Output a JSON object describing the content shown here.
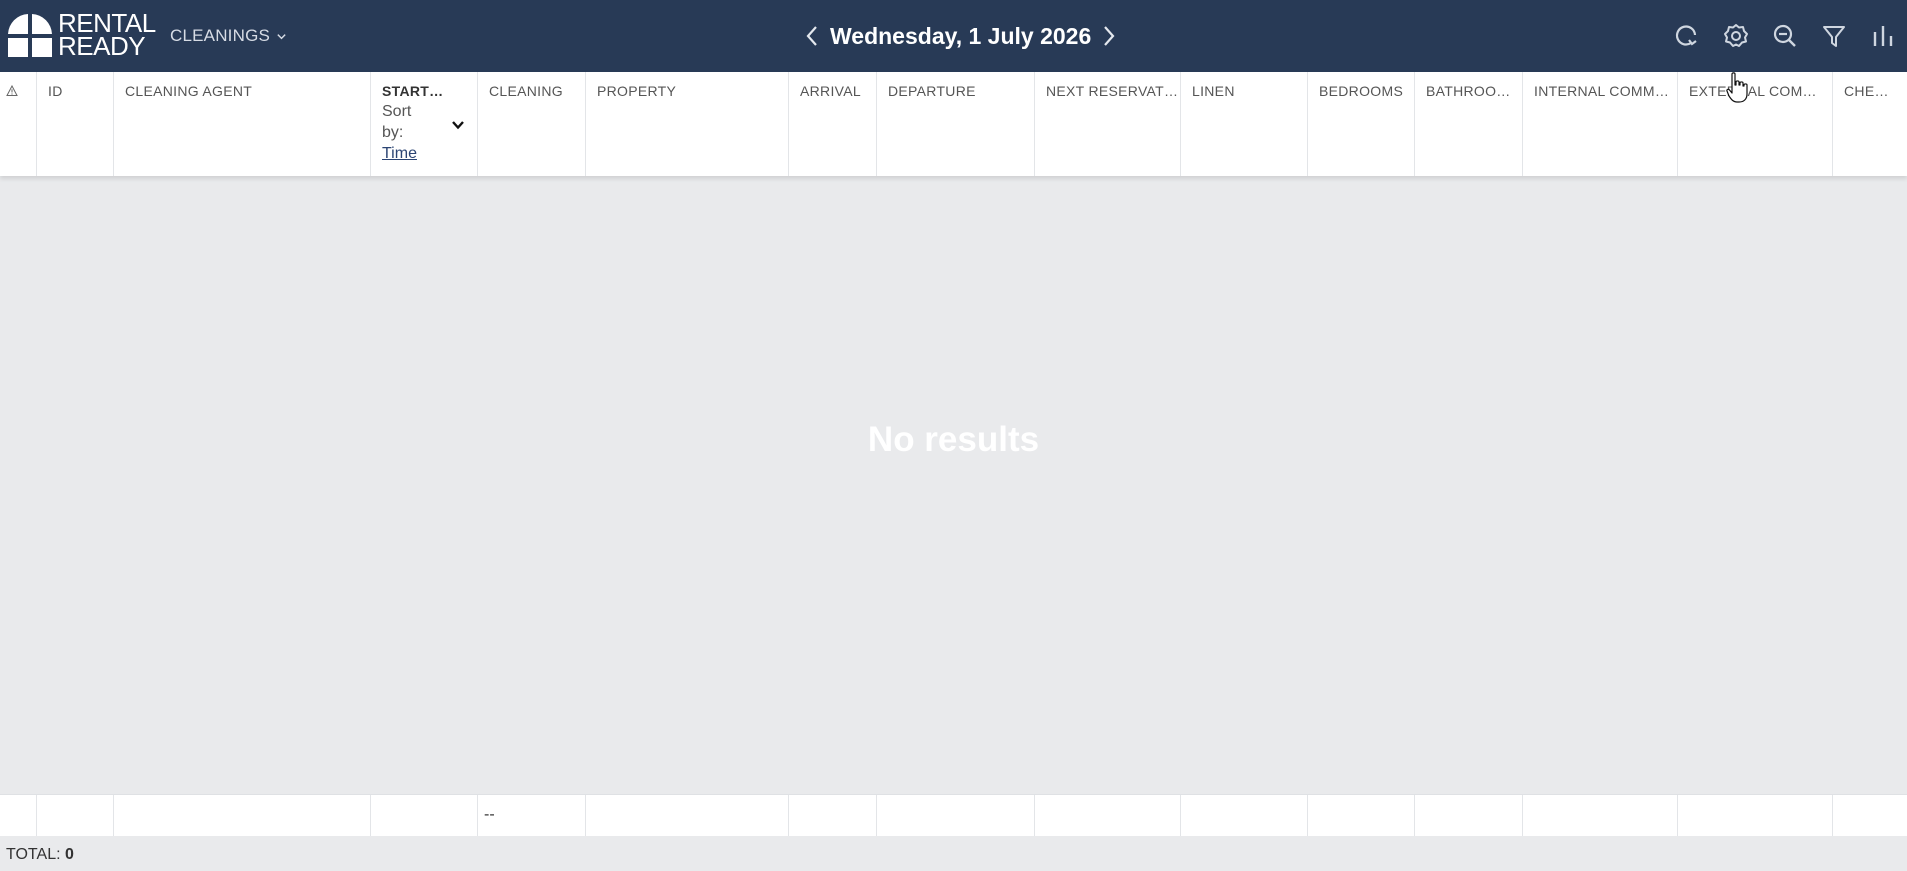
{
  "brand": {
    "line1": "RENTAL",
    "line2": "READY",
    "logo_icon": "rental-ready-logo"
  },
  "module": {
    "label": "CLEANINGS",
    "icon": "chevron-down-icon"
  },
  "date_nav": {
    "date": "Wednesday, 1 July 2026",
    "prev_icon": "chevron-left-icon",
    "next_icon": "chevron-right-icon"
  },
  "tools": [
    "refresh-icon",
    "settings-icon",
    "zoom-out-icon",
    "filter-icon",
    "columns-icon"
  ],
  "table": {
    "columns": [
      {
        "key": "warning",
        "label": "⚠"
      },
      {
        "key": "id",
        "label": "ID"
      },
      {
        "key": "cleaning_agent",
        "label": "CLEANING AGENT"
      },
      {
        "key": "start",
        "label": "START…"
      },
      {
        "key": "cleaning",
        "label": "CLEANING"
      },
      {
        "key": "property",
        "label": "PROPERTY"
      },
      {
        "key": "arrival",
        "label": "ARRIVAL"
      },
      {
        "key": "departure",
        "label": "DEPARTURE"
      },
      {
        "key": "next_reservation",
        "label": "NEXT RESERVAT…"
      },
      {
        "key": "linen",
        "label": "LINEN"
      },
      {
        "key": "bedrooms",
        "label": "BEDROOMS"
      },
      {
        "key": "bathrooms",
        "label": "BATHROO…"
      },
      {
        "key": "internal_comments",
        "label": "INTERNAL COMM…"
      },
      {
        "key": "external_comments",
        "label": "EXTERNAL COM…"
      },
      {
        "key": "checkin",
        "label": "CHE…"
      }
    ],
    "sort": {
      "prefix": "Sort by:",
      "value": "Time"
    },
    "empty_message": "No results",
    "footer": {
      "cleaning": "--"
    }
  },
  "total": {
    "label": "TOTAL:",
    "value": "0"
  },
  "colors": {
    "header_bg": "#283a56",
    "body_bg": "#e9eaec",
    "link": "#2b4473"
  }
}
